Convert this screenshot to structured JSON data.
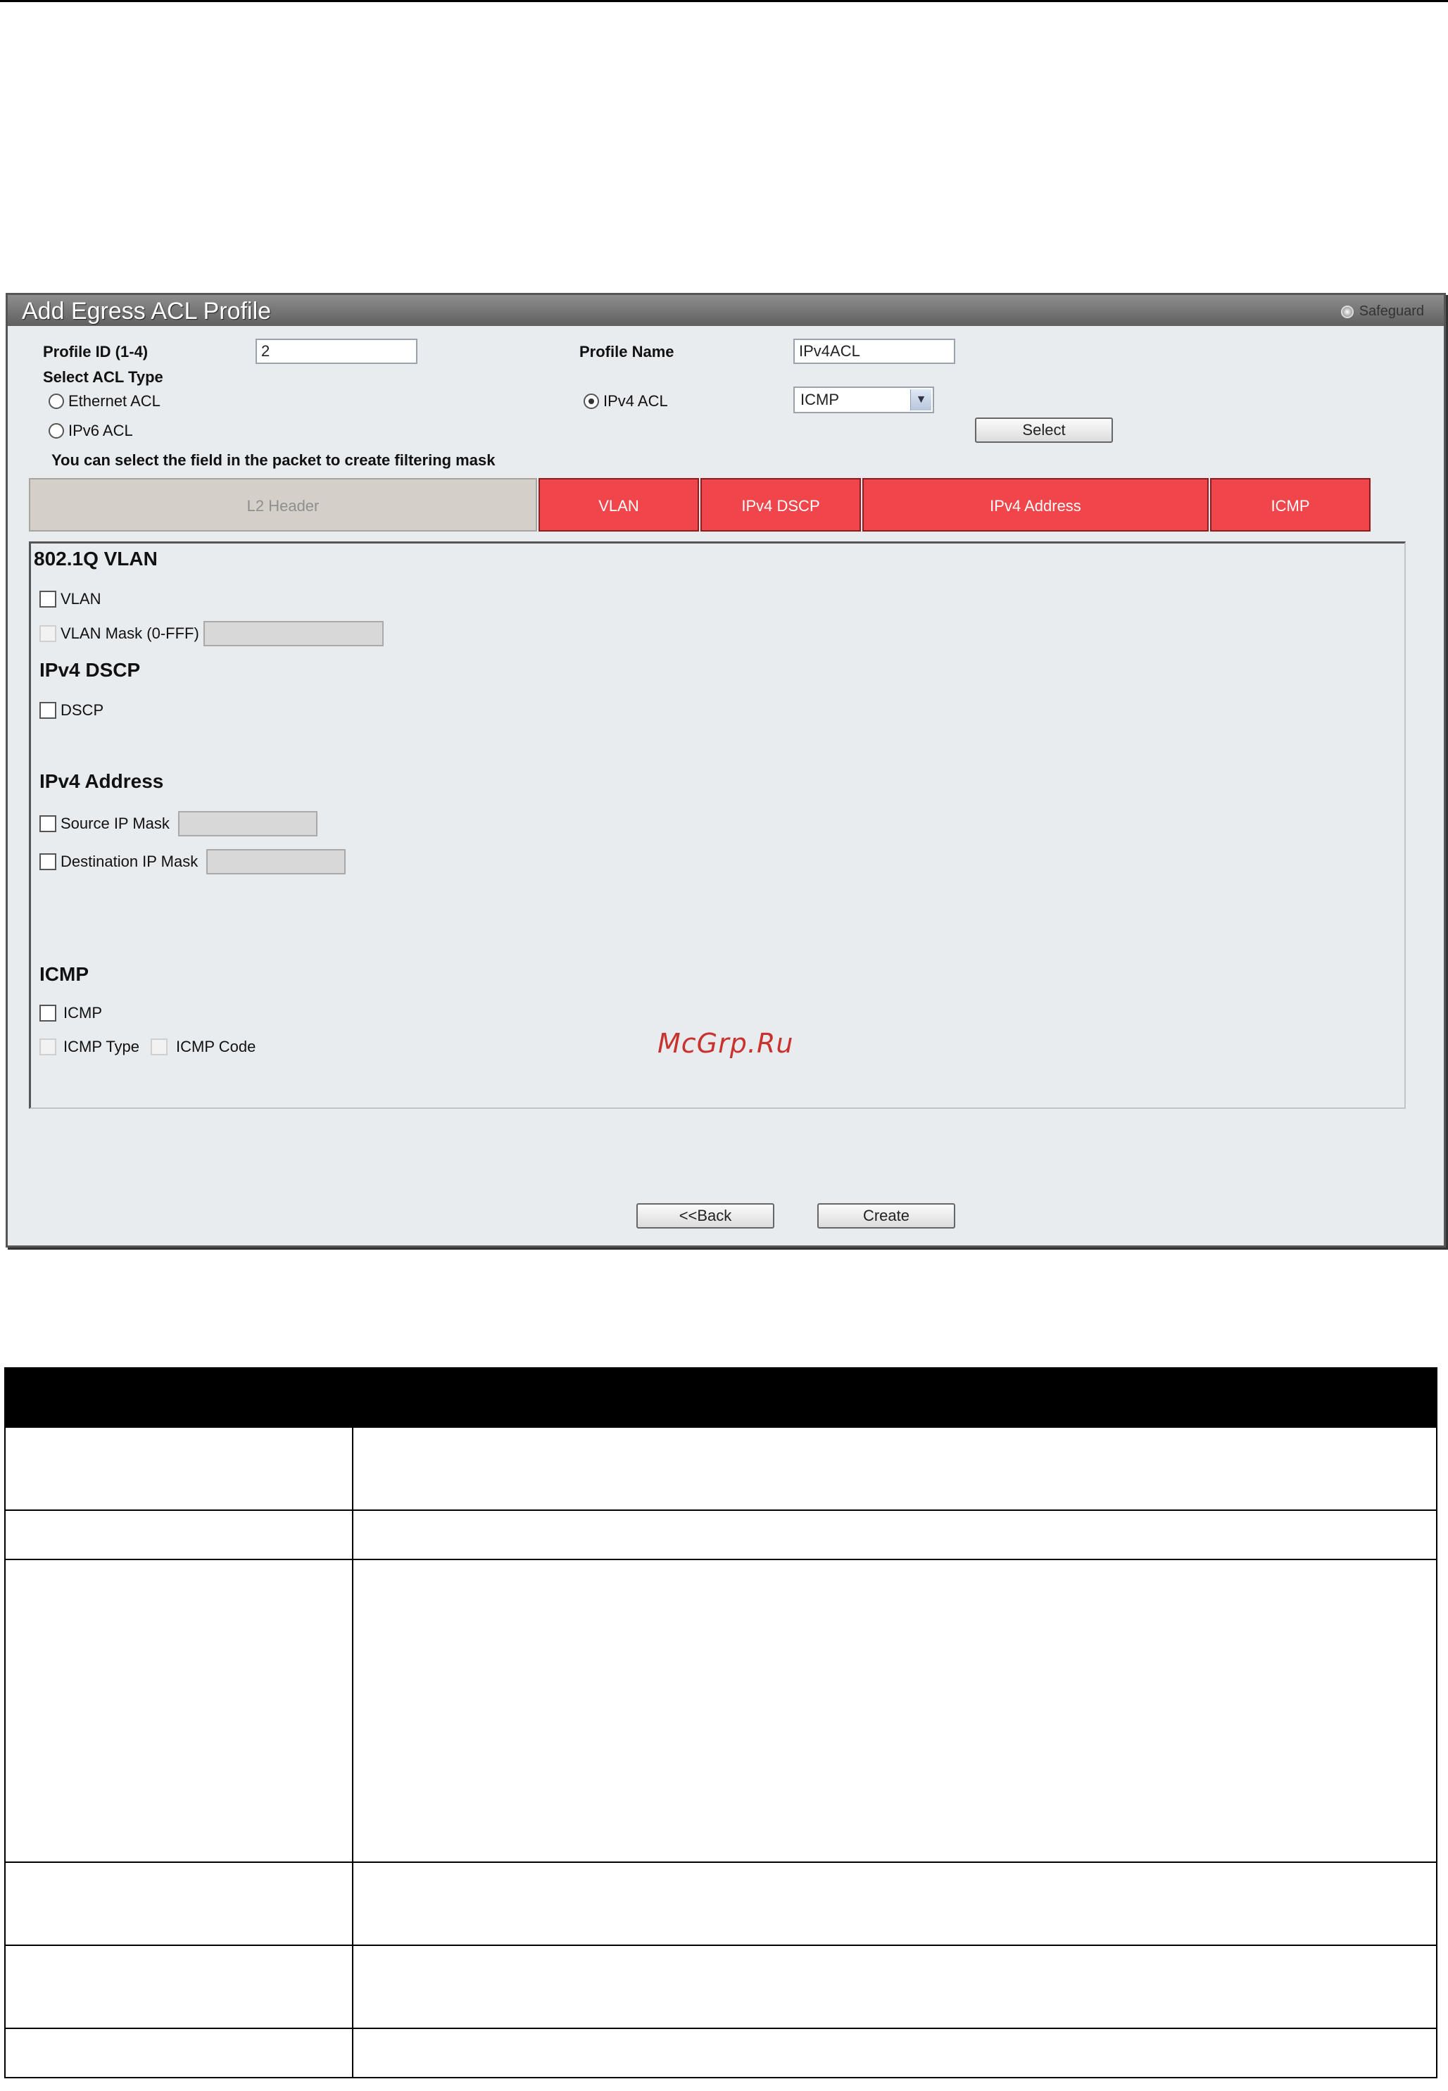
{
  "window": {
    "title": "Add Egress ACL Profile",
    "safeguard_label": "Safeguard"
  },
  "form": {
    "profile_id_label": "Profile ID (1-4)",
    "profile_id_value": "2",
    "profile_name_label": "Profile Name",
    "profile_name_value": "IPv4ACL",
    "select_acl_type_label": "Select ACL Type",
    "acl_types": [
      {
        "label": "Ethernet ACL",
        "checked": false
      },
      {
        "label": "IPv6 ACL",
        "checked": false
      },
      {
        "label": "IPv4 ACL",
        "checked": true
      }
    ],
    "protocol_select_value": "ICMP",
    "select_button_label": "Select",
    "hint_text": "You can select the field in the packet to create filtering mask"
  },
  "tabs": [
    {
      "label": "L2 Header",
      "active": false
    },
    {
      "label": "VLAN",
      "active": true
    },
    {
      "label": "IPv4 DSCP",
      "active": true
    },
    {
      "label": "IPv4 Address",
      "active": true
    },
    {
      "label": "ICMP",
      "active": true
    }
  ],
  "sections": {
    "vlan": {
      "heading": "802.1Q VLAN",
      "vlan_label": "VLAN",
      "vlan_mask_label": "VLAN Mask (0-FFF)"
    },
    "dscp": {
      "heading": "IPv4 DSCP",
      "dscp_label": "DSCP"
    },
    "address": {
      "heading": "IPv4 Address",
      "source_label": "Source IP Mask",
      "destination_label": "Destination IP Mask"
    },
    "icmp": {
      "heading": "ICMP",
      "icmp_label": "ICMP",
      "icmp_type_label": "ICMP Type",
      "icmp_code_label": "ICMP Code"
    }
  },
  "buttons": {
    "back_label": "<<Back",
    "create_label": "Create"
  },
  "watermark": "McGrp.Ru",
  "colors": {
    "tab_active": "#f0454a",
    "tab_disabled": "#d4d0c8",
    "titlebar": "#6f6f6f",
    "panel_bg": "#e9ecef",
    "watermark": "#c9332e"
  }
}
